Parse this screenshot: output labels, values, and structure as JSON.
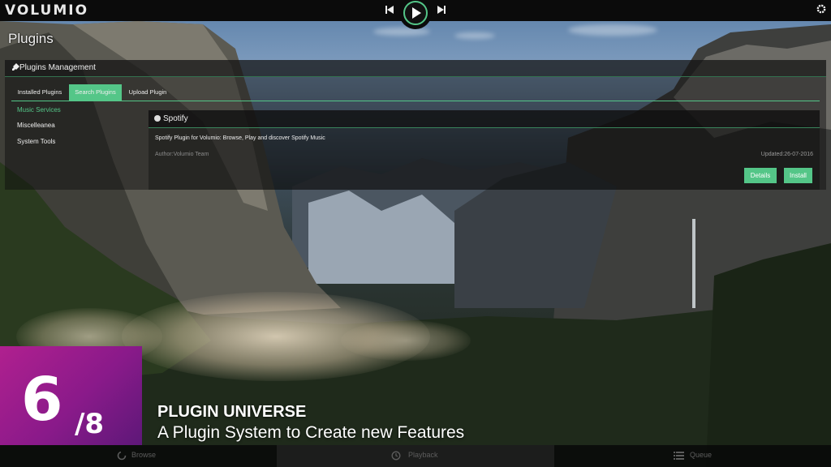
{
  "app": {
    "logo": "VOLUMIO"
  },
  "page": {
    "title": "Plugins"
  },
  "plugins_management": {
    "label": "Plugins Management"
  },
  "tabs": [
    {
      "label": "Installed Plugins",
      "active": false
    },
    {
      "label": "Search Plugins",
      "active": true
    },
    {
      "label": "Upload Plugin",
      "active": false
    }
  ],
  "categories": [
    {
      "label": "Music Services",
      "active": true
    },
    {
      "label": "Miscelleanea",
      "active": false
    },
    {
      "label": "System Tools",
      "active": false
    }
  ],
  "plugin": {
    "name": "Spotify",
    "description": "Spotify Plugin for Volumio: Browse, Play and discover Spotify Music",
    "author": "Author:Volumio Team",
    "updated": "Updated:26-07-2016",
    "details_label": "Details",
    "install_label": "Install"
  },
  "bottom_nav": [
    {
      "label": "Browse",
      "icon": "refresh-icon"
    },
    {
      "label": "Playback",
      "icon": "clock-icon"
    },
    {
      "label": "Queue",
      "icon": "list-icon"
    }
  ],
  "overlay": {
    "step_number": "6",
    "step_total": "/8",
    "title": "PLUGIN UNIVERSE",
    "subtitle": "A Plugin System to Create new Features"
  },
  "colors": {
    "accent": "#54c688",
    "badge": "#a3208d"
  }
}
